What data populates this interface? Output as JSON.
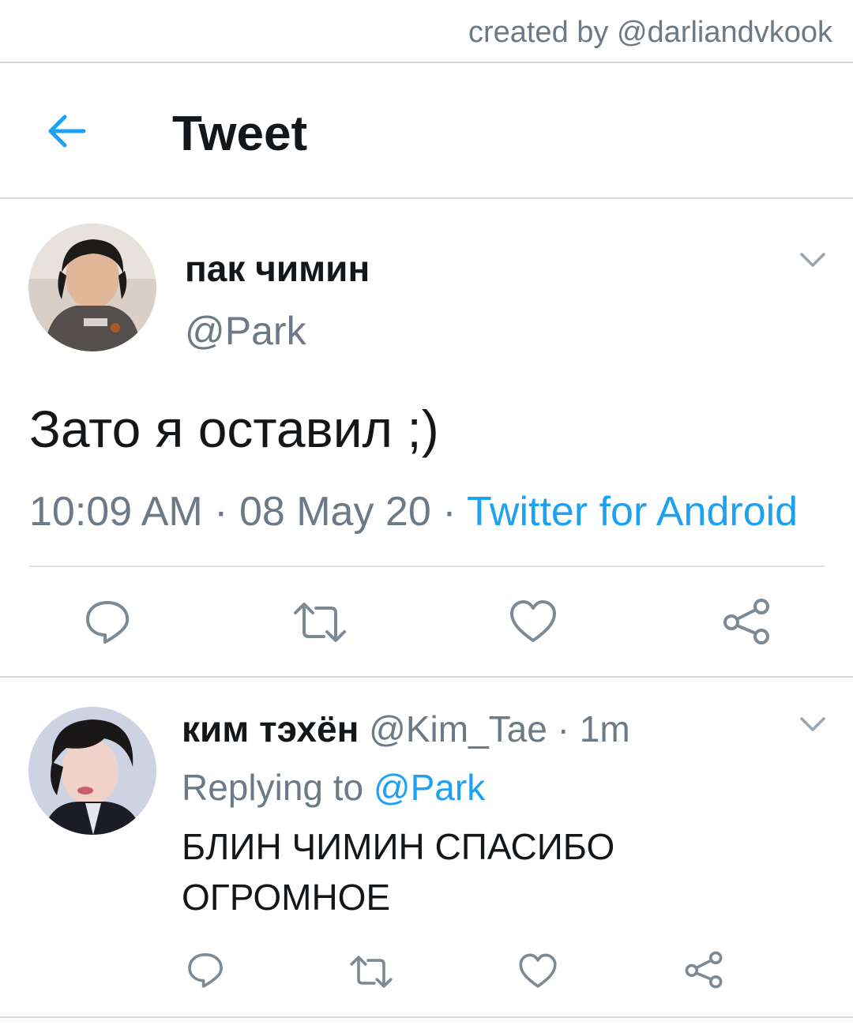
{
  "credit": "created by @darliandvkook",
  "header": {
    "title": "Tweet",
    "back_icon": "back-arrow-icon"
  },
  "tweet": {
    "author_name": "пак чимин",
    "author_handle": "@Park",
    "text": "Зато я оставил ;)",
    "time": "10:09 AM",
    "dot1": " · ",
    "date": "08 May 20",
    "dot2": " · ",
    "source": "Twitter for Android",
    "actions": [
      "reply-icon",
      "retweet-icon",
      "like-icon",
      "share-icon"
    ]
  },
  "reply": {
    "author_name": "ким тэхён",
    "author_handle": "@Kim_Tae",
    "dot": " · ",
    "time": "1m",
    "replying_to_label": "Replying to ",
    "replying_to_handle": "@Park",
    "text_line1": "БЛИН ЧИМИН СПАСИБО",
    "text_line2": "ОГРОМНОЕ",
    "actions": [
      "reply-icon",
      "retweet-icon",
      "like-icon",
      "share-icon"
    ]
  },
  "colors": {
    "accent": "#1da1f2",
    "text": "#14171a",
    "secondary": "#6b7a86",
    "icon": "#7c8a96",
    "divider": "#dde2e6"
  }
}
